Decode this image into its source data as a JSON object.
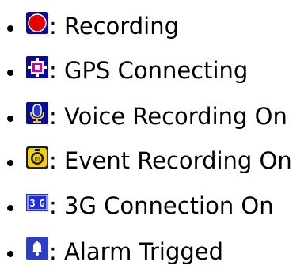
{
  "legend": {
    "items": [
      {
        "icon": "recording-icon",
        "label": ": Recording"
      },
      {
        "icon": "gps-connecting-icon",
        "label": ": GPS Connecting"
      },
      {
        "icon": "voice-recording-icon",
        "label": ": Voice Recording On"
      },
      {
        "icon": "event-recording-icon",
        "label": ": Event Recording On"
      },
      {
        "icon": "3g-connection-icon",
        "label": ": 3G Connection On"
      },
      {
        "icon": "alarm-icon",
        "label": ": Alarm Trigged"
      }
    ]
  },
  "colors": {
    "text": "#000000",
    "icon_frame": "#0a0a9a",
    "recording_red": "#e60000",
    "gps_magenta": "#d000a0",
    "voice_blue": "#2a3bd0",
    "event_yellow": "#f4d000",
    "net_blue": "#1c2ee0",
    "alarm_blue": "#2b3ec8"
  }
}
